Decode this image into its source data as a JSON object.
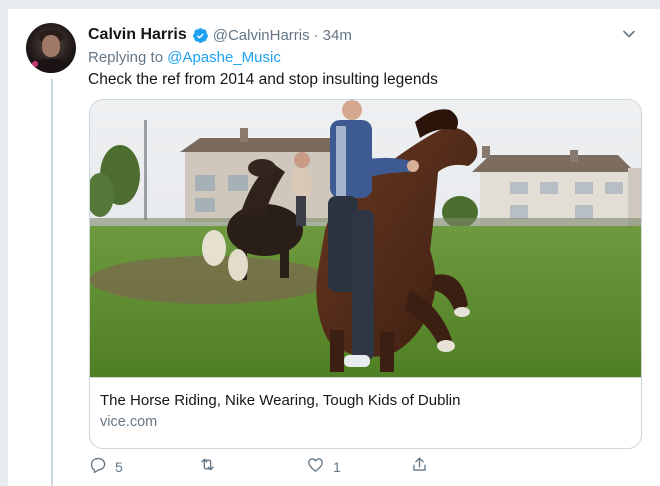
{
  "tweet": {
    "display_name": "Calvin Harris",
    "handle": "@CalvinHarris",
    "separator": "·",
    "time": "34m",
    "replying_prefix": "Replying to ",
    "replying_to": "@Apashe_Music",
    "text": "Check the ref from 2014 and stop insulting legends"
  },
  "link_card": {
    "title": "The Horse Riding, Nike Wearing, Tough Kids of Dublin",
    "domain": "vice.com"
  },
  "actions": {
    "reply_count": "5",
    "retweet_count": "",
    "like_count": "1"
  },
  "colors": {
    "accent": "#1da1f2",
    "secondary_text": "#657786",
    "border": "#ccd6dd"
  },
  "icons": [
    "verified-badge-icon",
    "chevron-down-icon",
    "reply-icon",
    "retweet-icon",
    "like-icon",
    "share-icon"
  ]
}
